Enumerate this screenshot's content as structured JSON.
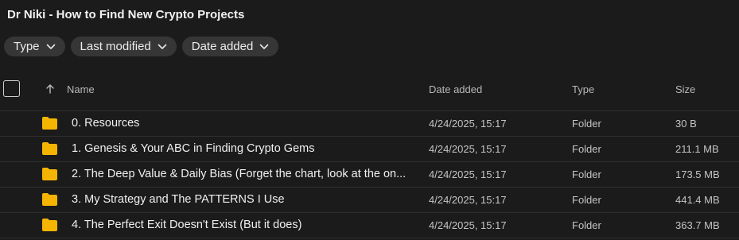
{
  "title": "Dr Niki - How to Find New Crypto Projects",
  "filters": [
    {
      "label": "Type"
    },
    {
      "label": "Last modified"
    },
    {
      "label": "Date added"
    }
  ],
  "columns": {
    "name": "Name",
    "date_added": "Date added",
    "type": "Type",
    "size": "Size"
  },
  "rows": [
    {
      "name": "0. Resources",
      "date_added": "4/24/2025, 15:17",
      "type": "Folder",
      "size": "30 B"
    },
    {
      "name": "1. Genesis & Your ABC in Finding Crypto Gems",
      "date_added": "4/24/2025, 15:17",
      "type": "Folder",
      "size": "211.1 MB"
    },
    {
      "name": "2. The Deep Value & Daily Bias (Forget the chart, look at the on...",
      "date_added": "4/24/2025, 15:17",
      "type": "Folder",
      "size": "173.5 MB"
    },
    {
      "name": "3. My Strategy and The PATTERNS I Use",
      "date_added": "4/24/2025, 15:17",
      "type": "Folder",
      "size": "441.4 MB"
    },
    {
      "name": "4. The Perfect Exit Doesn't Exist (But it does)",
      "date_added": "4/24/2025, 15:17",
      "type": "Folder",
      "size": "363.7 MB"
    }
  ],
  "colors": {
    "background": "#1b1b1b",
    "chip": "#363636",
    "folder": "#f5b400"
  },
  "icons": {
    "chip_caret": "chevron-down-icon",
    "sort": "arrow-up-icon",
    "row": "folder-icon"
  }
}
